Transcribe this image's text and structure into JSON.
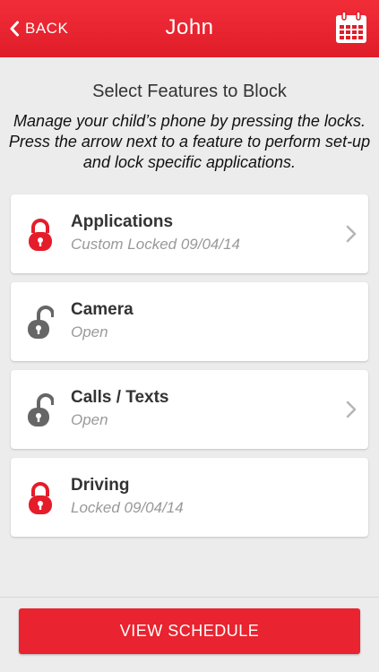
{
  "colors": {
    "accent": "#e9232f",
    "locked": "#e51c2a",
    "unlocked": "#666666",
    "background": "#ececec"
  },
  "header": {
    "back_label": "BACK",
    "back_icon": "chevron-left-icon",
    "title": "John",
    "calendar_icon": "calendar-icon"
  },
  "intro": {
    "heading": "Select Features to Block",
    "description": "Manage your child’s phone by pressing the locks. Press the arrow next to a feature to perform set-up and lock specific applications."
  },
  "features": [
    {
      "name": "Applications",
      "status": "Custom Locked 09/04/14",
      "locked": true,
      "has_arrow": true,
      "lock_icon": "lock-closed-icon"
    },
    {
      "name": "Camera",
      "status": "Open",
      "locked": false,
      "has_arrow": false,
      "lock_icon": "lock-open-icon"
    },
    {
      "name": "Calls / Texts",
      "status": "Open",
      "locked": false,
      "has_arrow": true,
      "lock_icon": "lock-open-icon"
    },
    {
      "name": "Driving",
      "status": "Locked 09/04/14",
      "locked": true,
      "has_arrow": false,
      "lock_icon": "lock-closed-icon"
    }
  ],
  "footer": {
    "schedule_label": "VIEW SCHEDULE"
  }
}
